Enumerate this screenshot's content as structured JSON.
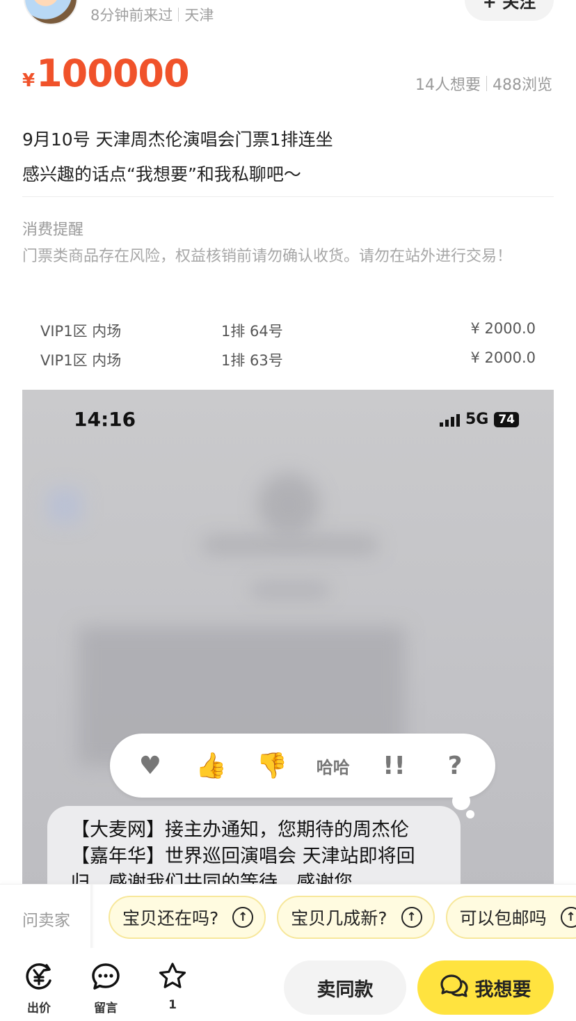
{
  "seller": {
    "last_seen": "8分钟前来过",
    "location": "天津",
    "follow_label": "+ 关注"
  },
  "price": {
    "currency": "¥",
    "amount": "100000"
  },
  "stats": {
    "wants": "14人想要",
    "views": "488浏览"
  },
  "description": {
    "line1": "9月10号 天津周杰伦演唱会门票1排连坐",
    "line2": "感兴趣的话点“我想要”和我私聊吧～"
  },
  "reminder": {
    "title": "消费提醒",
    "text": "门票类商品存在风险，权益核销前请勿确认收货。请勿在站外进行交易！"
  },
  "tickets": [
    {
      "zone": "VIP1区 内场",
      "seat": "1排 64号",
      "price": "¥ 2000.0"
    },
    {
      "zone": "VIP1区 内场",
      "seat": "1排 63号",
      "price": "¥ 2000.0"
    }
  ],
  "screenshot": {
    "time": "14:16",
    "network": "5G",
    "battery": "74",
    "reactions": [
      "♥",
      "👍",
      "👎",
      "哈哈",
      "!!",
      "?"
    ],
    "message": "【大麦网】接主办通知，您期待的周杰伦【嘉年华】世界巡回演唱会 天津站即将回归，感谢我们共同的等待，感谢您"
  },
  "ask": {
    "label": "问卖家",
    "chips": [
      "宝贝还在吗?",
      "宝贝几成新?",
      "可以包邮吗"
    ]
  },
  "bottom": {
    "offer_label": "出价",
    "comment_label": "留言",
    "fav_count": "1",
    "same_label": "卖同款",
    "want_label": "我想要"
  },
  "colors": {
    "price": "#f0522a",
    "want_button": "#ffe33f",
    "chip_bg": "#fffbe0"
  },
  "icons": [
    "yen-circle-icon",
    "comment-icon",
    "star-icon",
    "chat-bubble-icon",
    "arrow-up-icon"
  ]
}
